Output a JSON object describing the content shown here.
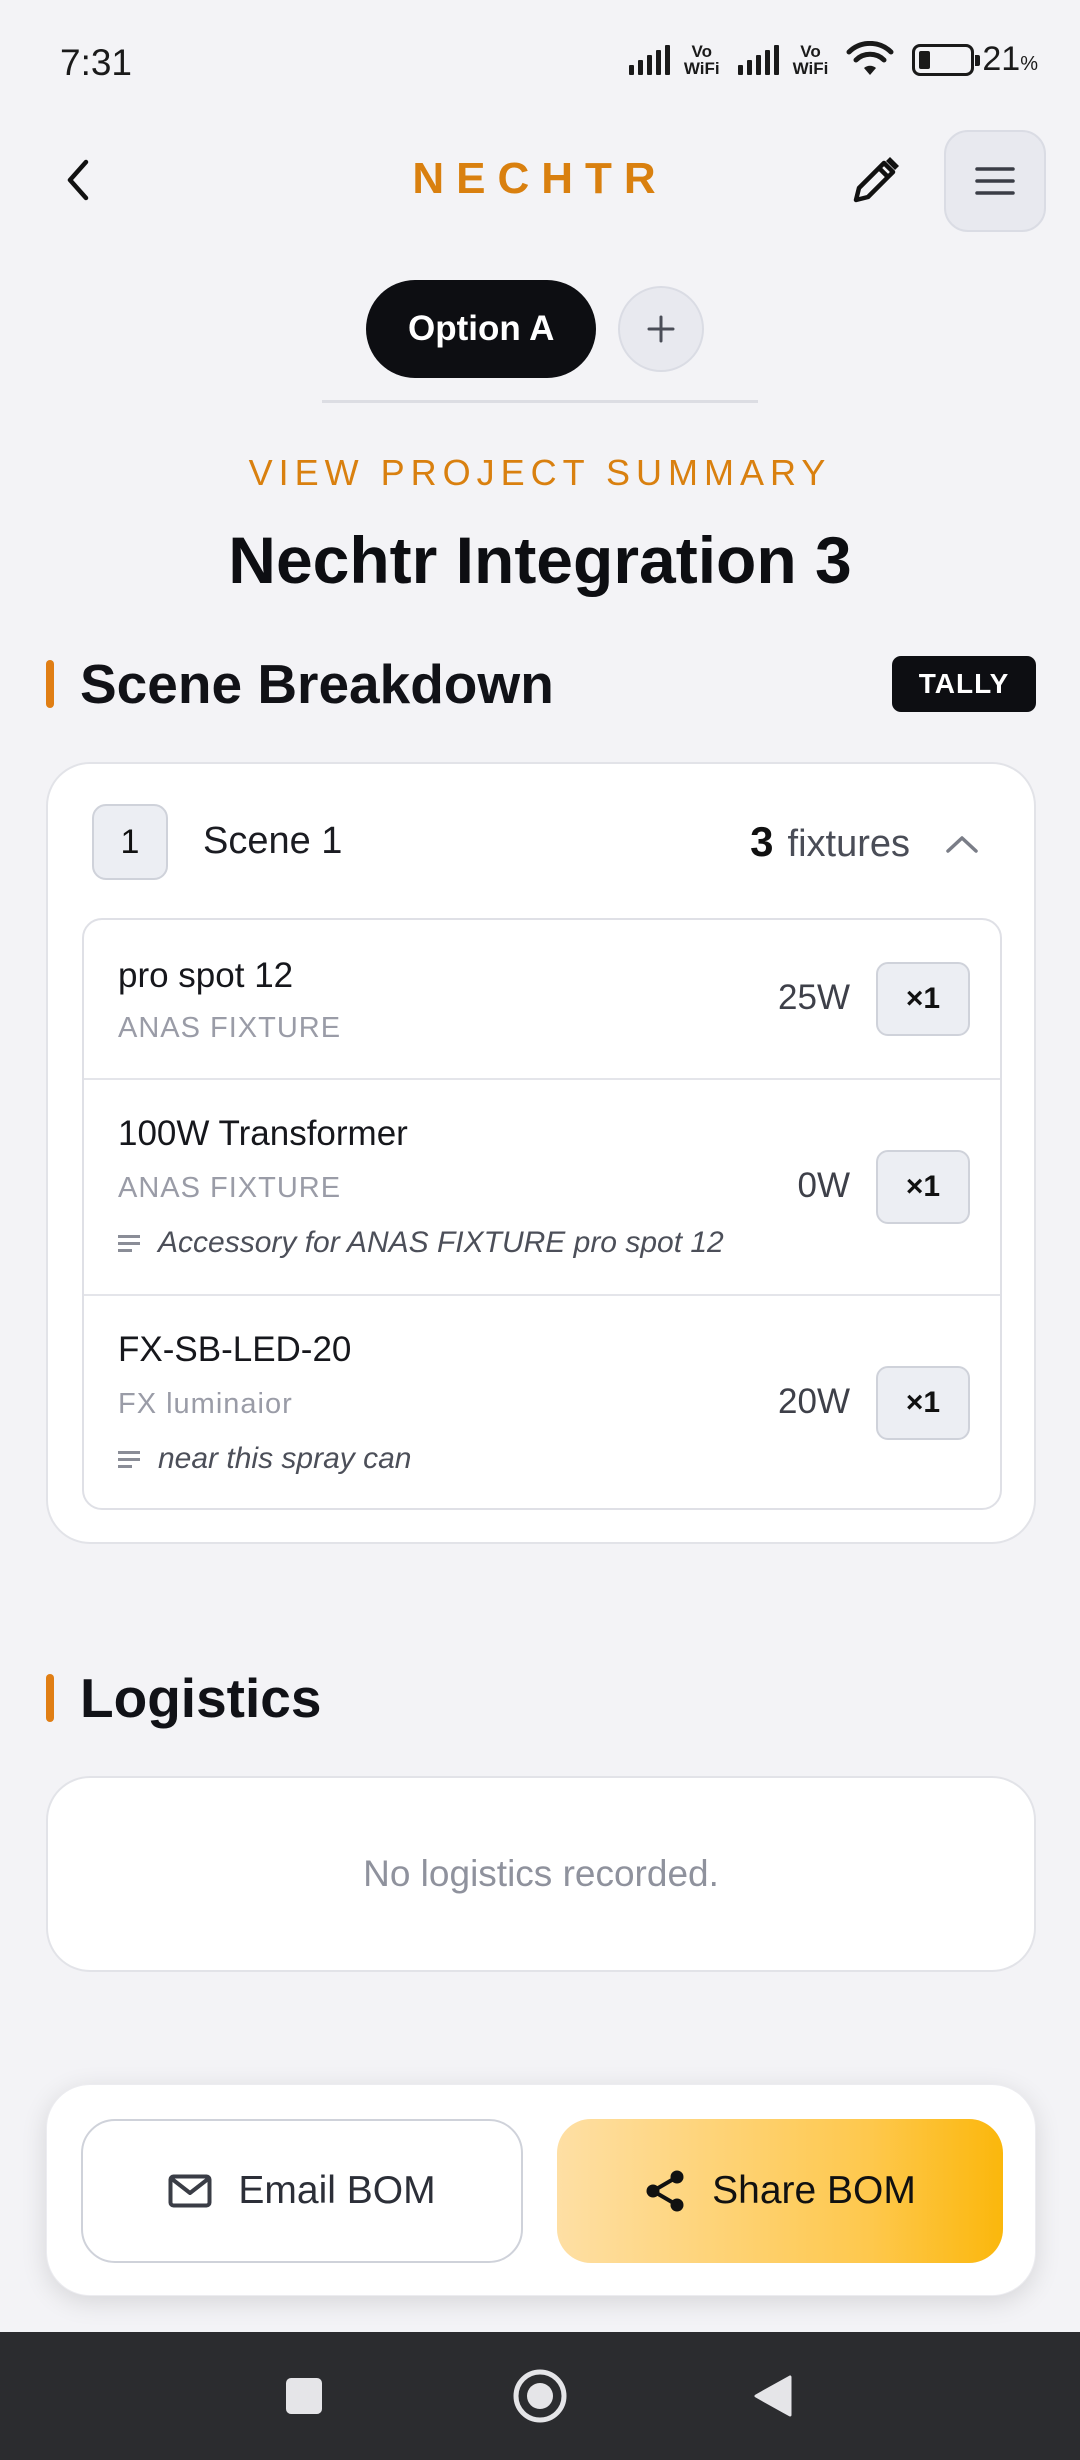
{
  "status_bar": {
    "time": "7:31",
    "vowifi_top": "Vo",
    "vowifi_bottom": "WiFi",
    "battery": "21",
    "battery_unit": "%"
  },
  "header": {
    "brand": "NECHTR"
  },
  "tabs": [
    {
      "label": "Option A",
      "active": true
    }
  ],
  "summary": {
    "kicker": "VIEW PROJECT SUMMARY",
    "title": "Nechtr Integration 3"
  },
  "scene_breakdown": {
    "title": "Scene Breakdown",
    "badge": "TALLY",
    "scenes": [
      {
        "number": "1",
        "name": "Scene 1",
        "fixture_count": "3",
        "fixture_label": "fixtures",
        "fixtures": [
          {
            "name": "pro spot 12",
            "brand": "ANAS FIXTURE",
            "watt": "25W",
            "qty": "×1",
            "note": ""
          },
          {
            "name": "100W Transformer",
            "brand": "ANAS FIXTURE",
            "watt": "0W",
            "qty": "×1",
            "note": "Accessory for ANAS FIXTURE pro spot 12"
          },
          {
            "name": "FX-SB-LED-20",
            "brand": "FX luminaior",
            "watt": "20W",
            "qty": "×1",
            "note": "near this spray can"
          }
        ]
      }
    ]
  },
  "logistics": {
    "title": "Logistics",
    "empty_text": "No logistics recorded."
  },
  "actions": {
    "email_label": "Email BOM",
    "share_label": "Share BOM"
  },
  "colors": {
    "accent": "#d9800f",
    "dark": "#0d0e12",
    "share_gradient_start": "#fedfa4",
    "share_gradient_end": "#fbb70c"
  }
}
